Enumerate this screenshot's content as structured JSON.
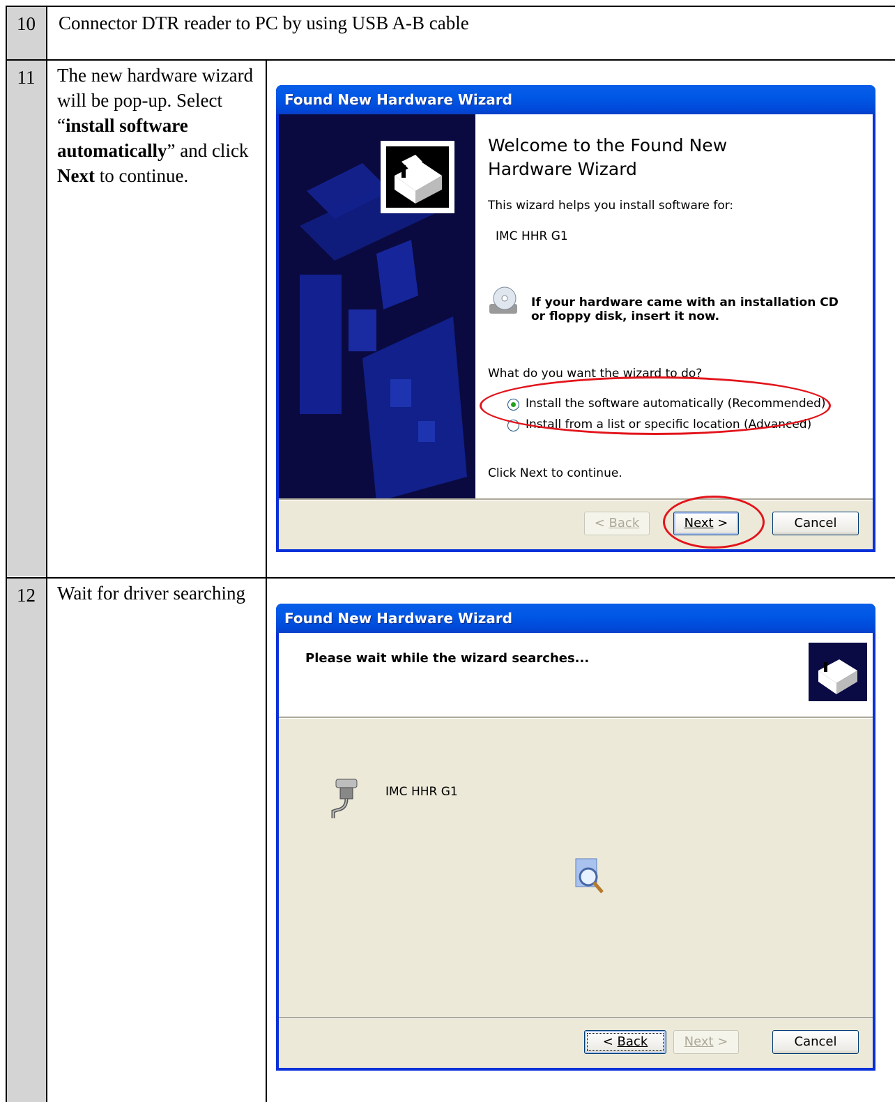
{
  "rows": [
    {
      "num": "10",
      "text": "Connector DTR reader to PC by using USB A-B cable"
    },
    {
      "num": "11",
      "text_parts": [
        "The new hardware wizard will be pop-up. Select “",
        "install software automatically",
        "” and click ",
        "Next",
        " to continue."
      ]
    },
    {
      "num": "12",
      "text": "Wait for driver searching"
    }
  ],
  "dialog1": {
    "title": "Found New Hardware Wizard",
    "heading": "Welcome to the Found New Hardware Wizard",
    "intro": "This wizard helps you install software for:",
    "device": "IMC HHR G1",
    "cd_note": "If your hardware came with an installation CD or floppy disk, insert it now.",
    "question": "What do you want the wizard to do?",
    "option_auto": "Install the software automatically (Recommended)",
    "option_list": "Install from a list or specific location (Advanced)",
    "selected_option": "auto",
    "footer": "Click Next to continue.",
    "back": "Back",
    "next": "Next",
    "cancel": "Cancel"
  },
  "dialog2": {
    "title": "Found New Hardware Wizard",
    "heading": "Please wait while the wizard searches...",
    "device": "IMC HHR G1",
    "back": "Back",
    "next": "Next",
    "cancel": "Cancel"
  },
  "colors": {
    "highlight": "#e2141b",
    "xp_blue": "#0831d9",
    "number_cell": "#d4d4d4"
  }
}
